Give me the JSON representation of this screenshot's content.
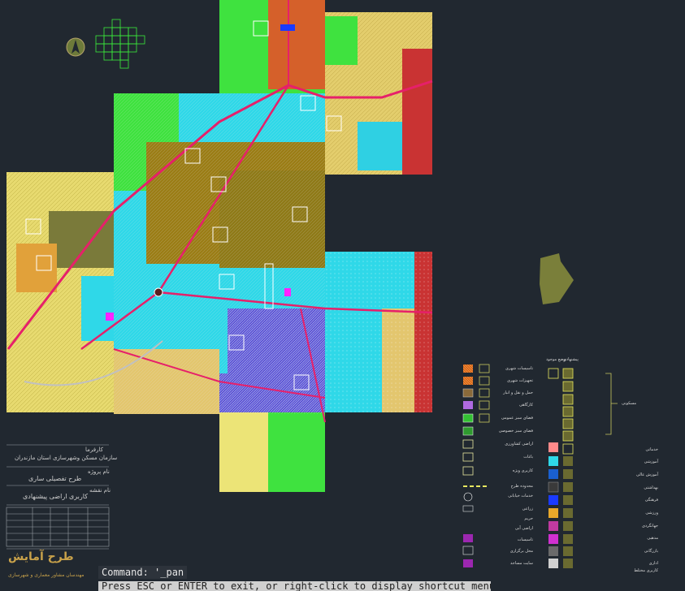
{
  "command": {
    "history": "Command: '_pan",
    "prompt": "Press ESC or ENTER to exit, or right-click to display shortcut menu."
  },
  "title_block": {
    "client_label": "کارفرما",
    "client": "سازمان مسکن وشهرسازی استان مازندران",
    "project_label": "نام پروژه",
    "project": "طرح تفصیلی ساری",
    "drawing_label": "نام نقشه",
    "drawing": "کاربری اراضی پیشنهادی",
    "consultant": "طرح آمایش",
    "consultant_sub": "مهندسان مشاور معماری و شهرسازی"
  },
  "legend": {
    "col_headers": [
      "وضع موجود",
      "پیشنهادی"
    ],
    "left_items": [
      "تاسیسات شهری",
      "تجهیزات شهری",
      "حمل و نقل و انبار",
      "کارگاهی",
      "فضای سبز عمومی",
      "فضای سبز خصوصی",
      "اراضی کشاورزی",
      "باغات",
      "کاربری ویژه",
      "محدوده طرح",
      "خدمات خیابانی",
      "زراعی",
      "حریم",
      "اراضی آبی",
      "تاسیسات",
      "محل برگزاری",
      "سایت مساجد"
    ],
    "right_items": [
      "مسکونی",
      "خدماتی",
      "آموزشی",
      "آموزش عالی",
      "بهداشتی",
      "فرهنگی",
      "ورزشی",
      "جهانگردی",
      "مذهبی",
      "بازرگانی",
      "اداری",
      "کاربری مختلط"
    ],
    "residential_group": "مسکونی"
  }
}
